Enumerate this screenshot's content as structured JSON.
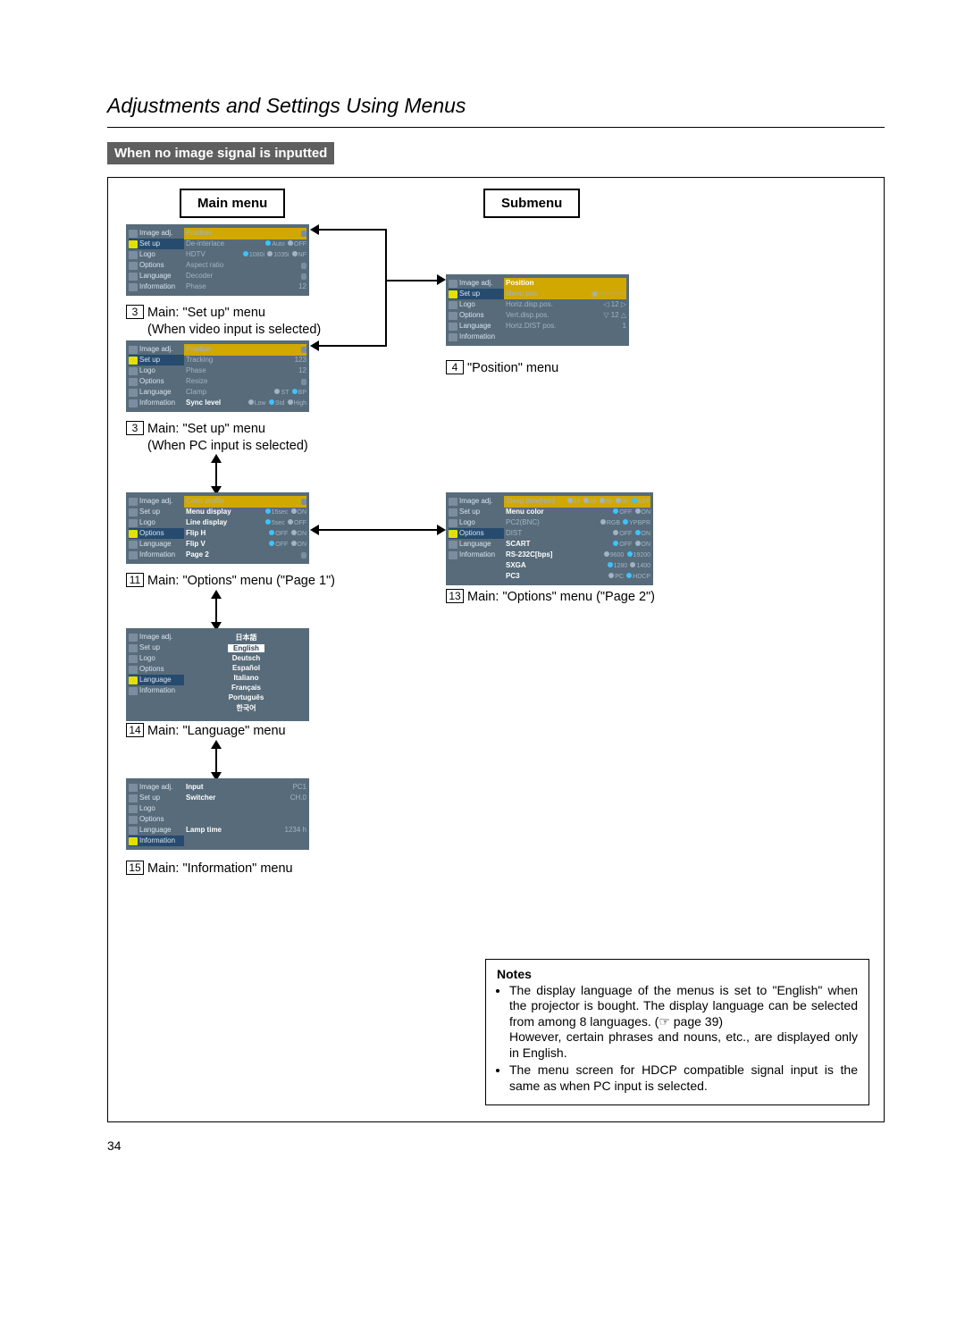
{
  "page": {
    "section_title": "Adjustments and Settings Using Menus",
    "banner": "When no image signal is inputted",
    "column_headers": {
      "main": "Main menu",
      "sub": "Submenu"
    },
    "page_number": "34"
  },
  "sidebar_items": [
    "Image adj.",
    "Set up",
    "Logo",
    "Options",
    "Language",
    "Information"
  ],
  "menus": {
    "setup_video": {
      "caption_num": "3",
      "caption_a": "Main: \"Set up\" menu",
      "caption_b": "(When video input is selected)",
      "active_index": 1,
      "rows": [
        {
          "k": "Position",
          "v_type": "pill",
          "v": "  "
        },
        {
          "k": "De-interlace",
          "v_type": "radio",
          "opts": [
            "Auto",
            "OFF"
          ],
          "sel": 0
        },
        {
          "k": "HDTV",
          "v_type": "radio",
          "opts": [
            "1080i",
            "1035i",
            "NF"
          ],
          "sel": 0
        },
        {
          "k": "Aspect ratio",
          "v_type": "pill",
          "v": "  "
        },
        {
          "k": "Decoder",
          "v_type": "pill",
          "v": "  "
        },
        {
          "k": "Phase",
          "v_type": "text",
          "v": "12"
        }
      ]
    },
    "setup_pc": {
      "caption_num": "3",
      "caption_a": "Main: \"Set up\" menu",
      "caption_b": "(When PC input is selected)",
      "active_index": 1,
      "rows": [
        {
          "k": "Position",
          "v_type": "pill",
          "v": "  "
        },
        {
          "k": "Tracking",
          "v_type": "text",
          "v": "123"
        },
        {
          "k": "Phase",
          "v_type": "text",
          "v": "12"
        },
        {
          "k": "Resize",
          "v_type": "pill",
          "v": "  "
        },
        {
          "k": "Clamp",
          "v_type": "radio",
          "opts": [
            "ST",
            "BP"
          ],
          "sel": 1
        },
        {
          "k": "Sync level",
          "v_type": "radio",
          "opts": [
            "Low",
            "Std",
            "High"
          ],
          "sel": 1,
          "k_hl": true
        }
      ]
    },
    "options_p1": {
      "caption_num": "11",
      "caption": "Main: \"Options\" menu (\"Page 1\")",
      "active_index": 3,
      "rows": [
        {
          "k": "Color profile",
          "v_type": "pill",
          "v": "  "
        },
        {
          "k": "Menu display",
          "v_type": "radio",
          "opts": [
            "15sec",
            "ON"
          ],
          "sel": 0,
          "k_hl": true
        },
        {
          "k": "Line display",
          "v_type": "radio",
          "opts": [
            "5sec",
            "OFF"
          ],
          "sel": 0,
          "k_hl": true
        },
        {
          "k": "Flip H",
          "v_type": "radio",
          "opts": [
            "OFF",
            "ON"
          ],
          "sel": 0,
          "k_hl": true
        },
        {
          "k": "Flip V",
          "v_type": "radio",
          "opts": [
            "OFF",
            "ON"
          ],
          "sel": 0,
          "k_hl": true
        },
        {
          "k": "Page 2",
          "v_type": "pill",
          "v": "  ",
          "k_hl": true
        }
      ]
    },
    "options_p2": {
      "caption_num": "13",
      "caption": "Main: \"Options\" menu (\"Page 2\")",
      "active_index": 3,
      "rows": [
        {
          "k": "Sleep time[min]",
          "v_type": "radio",
          "opts": [
            "15",
            "30",
            "60",
            "90",
            "OFF"
          ],
          "sel": 4,
          "row_hl": true
        },
        {
          "k": "Menu color",
          "v_type": "radio",
          "opts": [
            "OFF",
            "ON"
          ],
          "sel": 0,
          "k_hl": true
        },
        {
          "k": "PC2(BNC)",
          "v_type": "radio",
          "opts": [
            "RGB",
            "YPBPR"
          ],
          "sel": 1
        },
        {
          "k": "DIST",
          "v_type": "radio",
          "opts": [
            "OFF",
            "ON"
          ],
          "sel": 1
        },
        {
          "k": "SCART",
          "v_type": "radio",
          "opts": [
            "OFF",
            "ON"
          ],
          "sel": 0,
          "k_hl": true
        },
        {
          "k": "RS-232C[bps]",
          "v_type": "radio",
          "opts": [
            "9600",
            "19200"
          ],
          "sel": 1,
          "k_hl": true
        },
        {
          "k": "SXGA",
          "v_type": "radio",
          "opts": [
            "1280",
            "1400"
          ],
          "sel": 0,
          "k_hl": true
        },
        {
          "k": "PC3",
          "v_type": "radio",
          "opts": [
            "PC",
            "HDCP"
          ],
          "sel": 1,
          "k_hl": true
        }
      ]
    },
    "language": {
      "caption_num": "14",
      "caption": "Main: \"Language\" menu",
      "active_index": 4,
      "langs": [
        "日本語",
        "English",
        "Deutsch",
        "Español",
        "Italiano",
        "Français",
        "Português",
        "한국어"
      ],
      "selected": 1
    },
    "information": {
      "caption_num": "15",
      "caption": "Main: \"Information\" menu",
      "active_index": 5,
      "rows": [
        {
          "k": "Input",
          "v": "PC1",
          "k_hl": true
        },
        {
          "k": "Switcher",
          "v": "CH.0",
          "k_hl": true
        },
        {
          "k": "",
          "v": ""
        },
        {
          "k": "",
          "v": ""
        },
        {
          "k": "Lamp time",
          "v": "1234 h",
          "k_hl": true
        }
      ]
    },
    "position": {
      "caption_num": "4",
      "caption": "\"Position\" menu",
      "active_index": 1,
      "header": {
        "k": "Position",
        "hl": true
      },
      "rows": [
        {
          "k": "Menu pos.",
          "v_type": "grid",
          "row_hl": true
        },
        {
          "k": "Horiz.disp.pos.",
          "v_type": "hpos",
          "v": "12"
        },
        {
          "k": "Vert.disp.pos.",
          "v_type": "vpos",
          "v": "12"
        },
        {
          "k": "Horiz.DIST pos.",
          "v_type": "text",
          "v": "1"
        }
      ]
    }
  },
  "notes": {
    "heading": "Notes",
    "items": [
      "The display language of the menus is set to \"English\" when the projector is bought. The display language can be selected from among 8 languages. (☞ page 39)\nHowever, certain phrases and nouns, etc., are displayed only in English.",
      "The menu screen for HDCP compatible signal input is the same as when PC input is selected."
    ]
  }
}
